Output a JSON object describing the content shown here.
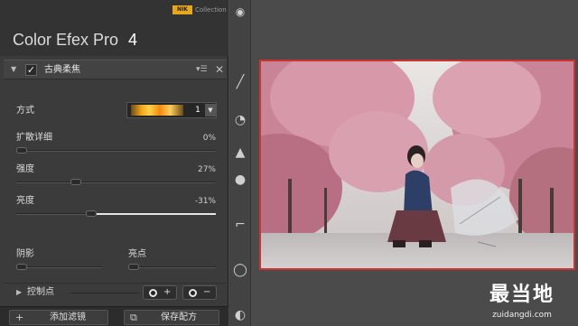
{
  "header": {
    "badge": "NIK",
    "collection": "Collection",
    "title": "Color Efex Pro",
    "version": "4"
  },
  "filter": {
    "name": "古典柔焦",
    "enabled": true,
    "collapse_icon": "triangle-down-icon",
    "menu_icon": "menu-icon",
    "close_icon": "close-icon"
  },
  "method": {
    "label": "方式",
    "value": "1"
  },
  "sliders": {
    "diffuse": {
      "label": "扩散详细",
      "value": "0%",
      "level": 0.0
    },
    "strength": {
      "label": "强度",
      "value": "27%",
      "level": 0.27
    },
    "brightness": {
      "label": "亮度",
      "value": "-31%",
      "level": 0.35
    },
    "shadows": {
      "label": "阴影",
      "level": 0.0
    },
    "highlights": {
      "label": "亮点",
      "level": 0.0
    }
  },
  "control_points": {
    "label": "控制点",
    "add_sign": "+",
    "remove_sign": "−"
  },
  "bottom": {
    "add_filter": "添加滤镜",
    "save_recipe": "保存配方"
  },
  "tools": [
    "eye-icon",
    "pen-icon",
    "circle-icon",
    "triangle-icon",
    "user-icon",
    "bracket-icon"
  ],
  "watermark": {
    "main": "最当地",
    "sub": "zuidangdi.com"
  },
  "colors": {
    "accent": "#e8a61c",
    "photo_border": "#cc3434"
  }
}
